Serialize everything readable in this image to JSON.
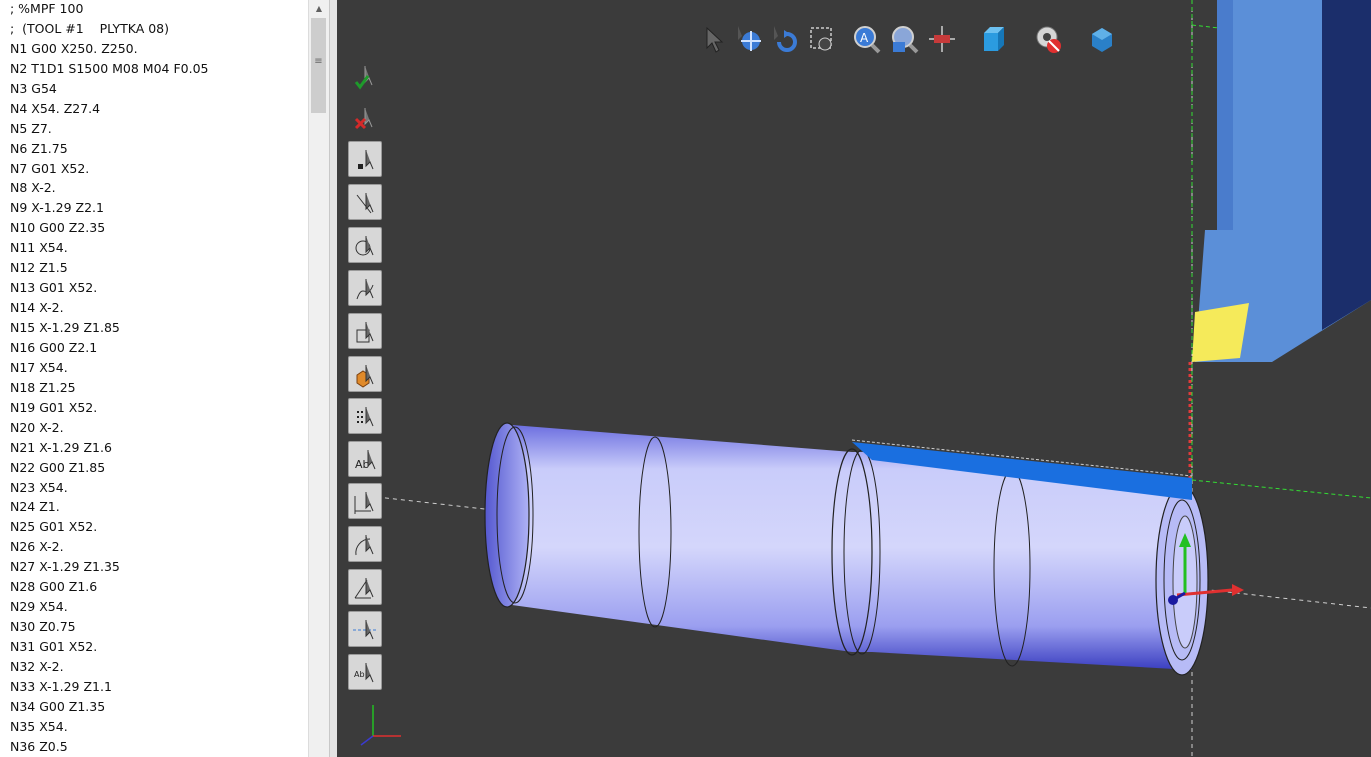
{
  "code_lines": [
    "; %MPF 100",
    ";  (TOOL #1    PLYTKA 08)",
    "N1 G00 X250. Z250.",
    "N2 T1D1 S1500 M08 M04 F0.05",
    "N3 G54",
    "N4 X54. Z27.4",
    "N5 Z7.",
    "N6 Z1.75",
    "N7 G01 X52.",
    "N8 X-2.",
    "N9 X-1.29 Z2.1",
    "N10 G00 Z2.35",
    "N11 X54.",
    "N12 Z1.5",
    "N13 G01 X52.",
    "N14 X-2.",
    "N15 X-1.29 Z1.85",
    "N16 G00 Z2.1",
    "N17 X54.",
    "N18 Z1.25",
    "N19 G01 X52.",
    "N20 X-2.",
    "N21 X-1.29 Z1.6",
    "N22 G00 Z1.85",
    "N23 X54.",
    "N24 Z1.",
    "N25 G01 X52.",
    "N26 X-2.",
    "N27 X-1.29 Z1.35",
    "N28 G00 Z1.6",
    "N29 X54.",
    "N30 Z0.75",
    "N31 G01 X52.",
    "N32 X-2.",
    "N33 X-1.29 Z1.1",
    "N34 G00 Z1.35",
    "N35 X54.",
    "N36 Z0.5"
  ],
  "top_toolbar_icons": [
    "select-arrow-icon",
    "pan-icon",
    "rotate-icon",
    "zoom-window-icon",
    "zoom-magnifier-icon",
    "zoom-fit-icon",
    "grid-crosshair-icon",
    "solid-cube-icon",
    "visibility-toggle-icon",
    "view-orientation-icon"
  ],
  "side_toolbar_icons": [
    "accept-check-icon",
    "reject-cross-icon",
    "select-point-icon",
    "select-line-icon",
    "select-circle-icon",
    "select-curve-icon",
    "select-face-icon",
    "select-solid-icon",
    "select-points-cloud-icon",
    "select-text-icon",
    "select-dimension-icon",
    "select-arc-icon",
    "select-angle-icon",
    "select-axis-icon",
    "select-annotation-icon"
  ],
  "colors": {
    "viewport_bg": "#3b3b3b",
    "part_fill": "#aab0f2",
    "tool_body": "#5b8fd8",
    "insert": "#f5ea5a",
    "toolpath": "#1a6fe0",
    "axis_x": "#e03030",
    "axis_y": "#22c022",
    "axis_z": "#1a1aa0"
  }
}
